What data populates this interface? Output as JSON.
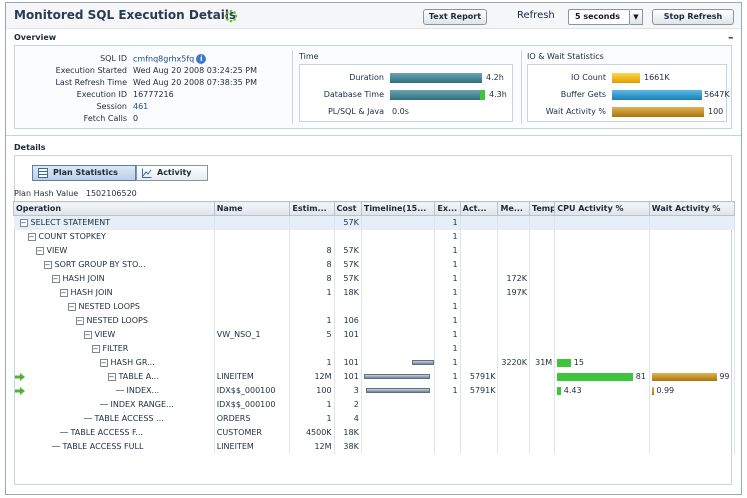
{
  "header": {
    "title": "Monitored SQL Execution Details",
    "text_report_label": "Text Report",
    "refresh_label": "Refresh",
    "refresh_value": "5 seconds",
    "stop_refresh_label": "Stop Refresh"
  },
  "overview": {
    "title": "Overview",
    "minimize": "–",
    "fields": [
      {
        "label": "SQL ID",
        "value": "cmfnq8grhx5fq"
      },
      {
        "label": "Execution Started",
        "value": "Wed Aug 20 2008 03:24:25 PM"
      },
      {
        "label": "Last Refresh Time",
        "value": "Wed Aug 20 2008 07:38:35 PM"
      },
      {
        "label": "Execution ID",
        "value": "16777216"
      },
      {
        "label": "Session",
        "value": "461"
      },
      {
        "label": "Fetch Calls",
        "value": "0"
      }
    ],
    "time": {
      "title": "Time",
      "duration_label": "Duration",
      "duration_value": "4.2h",
      "db_time_label": "Database Time",
      "db_time_value": "4.3h",
      "plsql_label": "PL/SQL & Java",
      "plsql_value": "0.0s"
    },
    "io": {
      "title": "IO & Wait Statistics",
      "io_count_label": "IO Count",
      "io_count_value": "1661K",
      "buffer_gets_label": "Buffer Gets",
      "buffer_gets_value": "5647K",
      "wait_activity_label": "Wait Activity %",
      "wait_activity_value": "100"
    }
  },
  "details": {
    "title": "Details",
    "tab_plan": "Plan Statistics",
    "tab_activity": "Activity",
    "plan_hash_label": "Plan Hash Value",
    "plan_hash_value": "1502106520",
    "columns": [
      "Operation",
      "Name",
      "Estim...",
      "Cost",
      "Timeline(15...",
      "Ex...",
      "Act...",
      "Me...",
      "Temp",
      "CPU Activity %",
      "Wait Activity %"
    ],
    "rows": [
      {
        "op": "SELECT STATEMENT",
        "name": "",
        "est": "",
        "cost": "57K",
        "exec": "1",
        "act": "",
        "mem": "",
        "temp": "",
        "cpu": "",
        "wait": ""
      },
      {
        "op": "COUNT STOPKEY",
        "name": "",
        "est": "",
        "cost": "",
        "exec": "1",
        "act": "",
        "mem": "",
        "temp": "",
        "cpu": "",
        "wait": ""
      },
      {
        "op": "VIEW",
        "name": "",
        "est": "8",
        "cost": "57K",
        "exec": "1",
        "act": "",
        "mem": "",
        "temp": "",
        "cpu": "",
        "wait": ""
      },
      {
        "op": "SORT GROUP BY STO...",
        "name": "",
        "est": "8",
        "cost": "57K",
        "exec": "1",
        "act": "",
        "mem": "",
        "temp": "",
        "cpu": "",
        "wait": ""
      },
      {
        "op": "HASH JOIN",
        "name": "",
        "est": "8",
        "cost": "57K",
        "exec": "1",
        "act": "",
        "mem": "172K",
        "temp": "",
        "cpu": "",
        "wait": ""
      },
      {
        "op": "HASH JOIN",
        "name": "",
        "est": "1",
        "cost": "18K",
        "exec": "1",
        "act": "",
        "mem": "197K",
        "temp": "",
        "cpu": "",
        "wait": ""
      },
      {
        "op": "NESTED LOOPS",
        "name": "",
        "est": "",
        "cost": "",
        "exec": "1",
        "act": "",
        "mem": "",
        "temp": "",
        "cpu": "",
        "wait": ""
      },
      {
        "op": "NESTED LOOPS",
        "name": "",
        "est": "1",
        "cost": "106",
        "exec": "1",
        "act": "",
        "mem": "",
        "temp": "",
        "cpu": "",
        "wait": ""
      },
      {
        "op": "VIEW",
        "name": "VW_NSO_1",
        "est": "5",
        "cost": "101",
        "exec": "1",
        "act": "",
        "mem": "",
        "temp": "",
        "cpu": "",
        "wait": ""
      },
      {
        "op": "FILTER",
        "name": "",
        "est": "",
        "cost": "",
        "exec": "1",
        "act": "",
        "mem": "",
        "temp": "",
        "cpu": "",
        "wait": ""
      },
      {
        "op": "HASH GR...",
        "name": "",
        "est": "1",
        "cost": "101",
        "exec": "1",
        "act": "",
        "mem": "3220K",
        "temp": "31M",
        "cpu": "15",
        "wait": ""
      },
      {
        "op": "TABLE A...",
        "name": "LINEITEM",
        "est": "12M",
        "cost": "101",
        "exec": "1",
        "act": "5791K",
        "mem": "",
        "temp": "",
        "cpu": "81",
        "wait": "99"
      },
      {
        "op": "INDEX...",
        "name": "IDX$$_000100",
        "est": "100",
        "cost": "3",
        "exec": "1",
        "act": "5791K",
        "mem": "",
        "temp": "",
        "cpu": "4.43",
        "wait": "0.99"
      },
      {
        "op": "INDEX RANGE...",
        "name": "IDX$$_000100",
        "est": "1",
        "cost": "2",
        "exec": "",
        "act": "",
        "mem": "",
        "temp": "",
        "cpu": "",
        "wait": ""
      },
      {
        "op": "TABLE ACCESS ...",
        "name": "ORDERS",
        "est": "1",
        "cost": "4",
        "exec": "",
        "act": "",
        "mem": "",
        "temp": "",
        "cpu": "",
        "wait": ""
      },
      {
        "op": "TABLE ACCESS F...",
        "name": "CUSTOMER",
        "est": "4500K",
        "cost": "18K",
        "exec": "",
        "act": "",
        "mem": "",
        "temp": "",
        "cpu": "",
        "wait": ""
      },
      {
        "op": "TABLE ACCESS FULL",
        "name": "LINEITEM",
        "est": "12M",
        "cost": "38K",
        "exec": "",
        "act": "",
        "mem": "",
        "temp": "",
        "cpu": "",
        "wait": ""
      }
    ]
  },
  "colors": {
    "time_bar": "#3f7e8c",
    "io_count_bar": "#f0b400",
    "buffer_gets_bar": "#1f8fc8",
    "wait_bar": "#c48a1a",
    "cpu_green": "#3cc43c",
    "wait_orange": "#c48a1a"
  }
}
